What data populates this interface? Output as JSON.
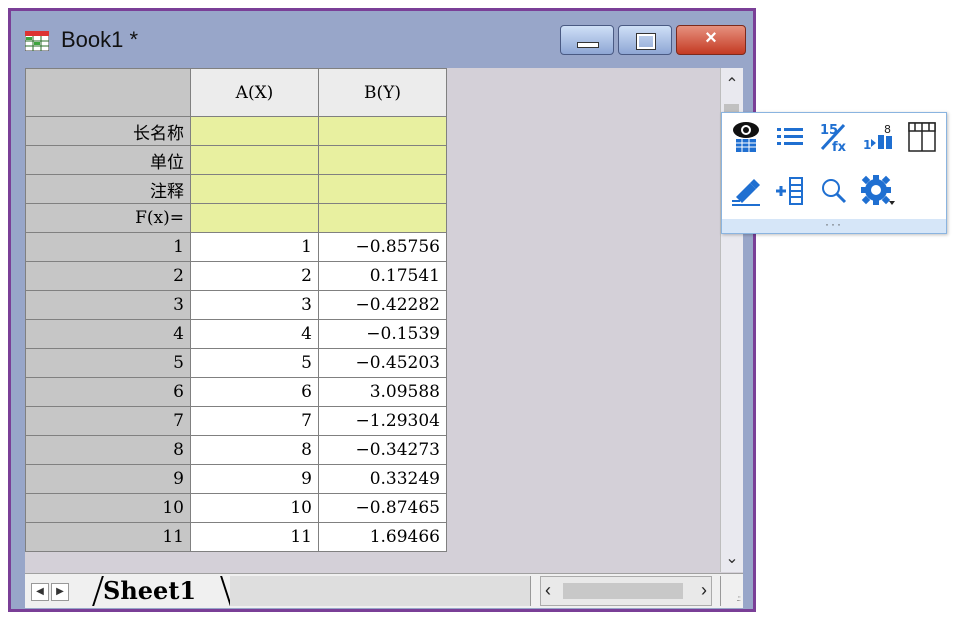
{
  "window": {
    "title": "Book1 *",
    "controls": {
      "minimize": "minimize",
      "maximize": "maximize",
      "close": "×"
    }
  },
  "grid": {
    "columns": [
      {
        "header": "A(X)"
      },
      {
        "header": "B(Y)"
      }
    ],
    "meta_rows": [
      "长名称",
      "单位",
      "注释",
      "F(x)="
    ],
    "rows": [
      {
        "index": "1",
        "a": "1",
        "b": "−0.85756"
      },
      {
        "index": "2",
        "a": "2",
        "b": "0.17541"
      },
      {
        "index": "3",
        "a": "3",
        "b": "−0.42282"
      },
      {
        "index": "4",
        "a": "4",
        "b": "−0.1539"
      },
      {
        "index": "5",
        "a": "5",
        "b": "−0.45203"
      },
      {
        "index": "6",
        "a": "6",
        "b": "3.09588"
      },
      {
        "index": "7",
        "a": "7",
        "b": "−1.29304"
      },
      {
        "index": "8",
        "a": "8",
        "b": "−0.34273"
      },
      {
        "index": "9",
        "a": "9",
        "b": "0.33249"
      },
      {
        "index": "10",
        "a": "10",
        "b": "−0.87465"
      },
      {
        "index": "11",
        "a": "11",
        "b": "1.69466"
      }
    ]
  },
  "sheet_tabs": {
    "active": "Sheet1"
  },
  "toolbar": {
    "icons": [
      "show-hide-icon",
      "list-icon",
      "fraction-format-icon",
      "sort-icon",
      "column-layout-icon",
      "highlight-icon",
      "add-column-icon",
      "zoom-icon",
      "settings-gear-icon"
    ],
    "drag_handle": "···"
  },
  "colors": {
    "window_border": "#7a3f97",
    "meta_row_fill": "#e8f0a0",
    "header_fill": "#c6c6c6",
    "toolbar_blue": "#1f6fd1"
  }
}
